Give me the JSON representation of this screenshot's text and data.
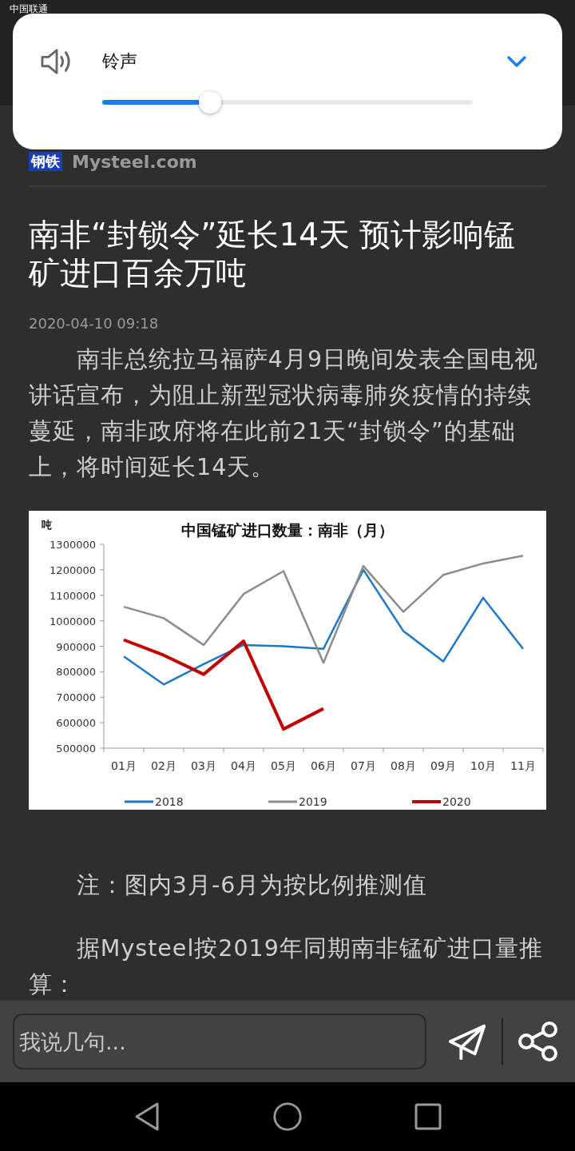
{
  "status_bar": {
    "carrier": "中国联通"
  },
  "volume_panel": {
    "label": "铃声",
    "level": 0.29
  },
  "site_logo": {
    "mark": "钢铁",
    "name": "Mysteel.com"
  },
  "article": {
    "title": "南非“封锁令”延长14天 预计影响锰矿进口百余万吨",
    "date": "2020-04-10 09:18",
    "paragraphs": [
      "南非总统拉马福萨4月9日晚间发表全国电视讲话宣布，为阻止新型冠状病毒肺炎疫情的持续蔓延，南非政府将在此前21天“封锁令”的基础上，将时间延长14天。"
    ],
    "chart_data": {
      "type": "line",
      "title": "中国锰矿进口数量：南非（月）",
      "ylabel": "吨",
      "categories": [
        "01月",
        "02月",
        "03月",
        "04月",
        "05月",
        "06月",
        "07月",
        "08月",
        "09月",
        "10月",
        "11月"
      ],
      "series": [
        {
          "name": "2018",
          "color": "#1f77c4",
          "values": [
            860000,
            750000,
            830000,
            905000,
            900000,
            890000,
            1200000,
            960000,
            840000,
            1090000,
            890000
          ]
        },
        {
          "name": "2019",
          "color": "#8c8c8c",
          "values": [
            1055000,
            1010000,
            905000,
            1105000,
            1195000,
            835000,
            1215000,
            1035000,
            1180000,
            1225000,
            1255000
          ]
        },
        {
          "name": "2020",
          "color": "#c00000",
          "values": [
            925000,
            865000,
            790000,
            920000,
            575000,
            655000,
            null,
            null,
            null,
            null,
            null
          ]
        }
      ],
      "legend": "bottom",
      "ylim": [
        500000,
        1300000
      ],
      "yticks": [
        500000,
        600000,
        700000,
        800000,
        900000,
        1000000,
        1100000,
        1200000,
        1300000
      ]
    },
    "after_chart": [
      "注：图内3月-6月为按比例推测值",
      "据Mysteel按2019年同期南非锰矿进口量推算："
    ]
  },
  "comment_bar": {
    "placeholder": "我说几句..."
  }
}
